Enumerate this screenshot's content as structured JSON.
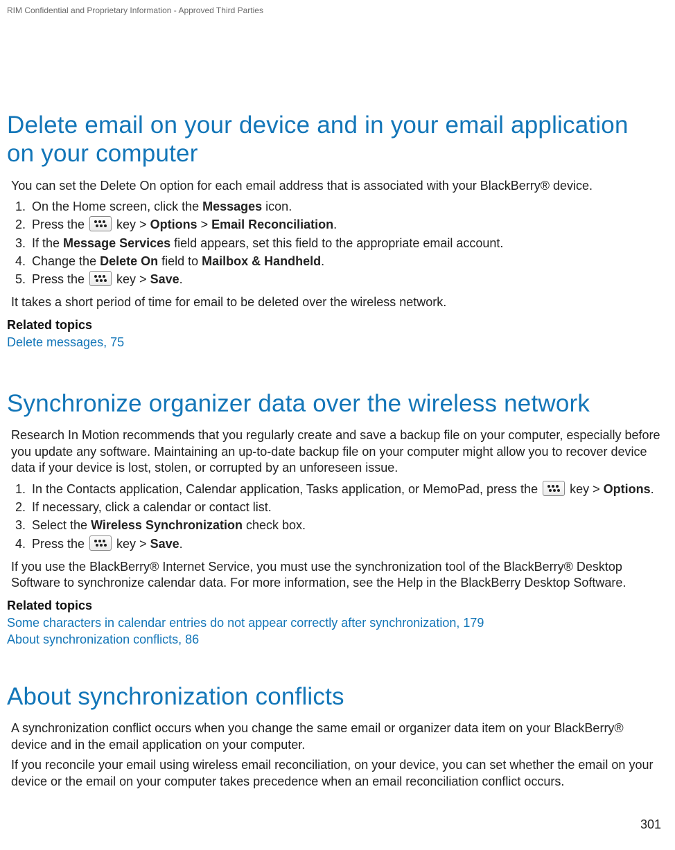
{
  "header": {
    "confidential": "RIM Confidential and Proprietary Information - Approved Third Parties"
  },
  "page_number": "301",
  "section1": {
    "title": "Delete email on your device and in your email application on your computer",
    "intro": "You can set the Delete On option for each email address that is associated with your BlackBerry® device.",
    "steps": {
      "s1_a": "On the Home screen, click the ",
      "s1_b": "Messages",
      "s1_c": " icon.",
      "s2_a": "Press the ",
      "s2_b": " key > ",
      "s2_c": "Options",
      "s2_d": " > ",
      "s2_e": "Email Reconciliation",
      "s2_f": ".",
      "s3_a": "If the ",
      "s3_b": "Message Services",
      "s3_c": " field appears, set this field to the appropriate email account.",
      "s4_a": "Change the ",
      "s4_b": "Delete On",
      "s4_c": " field to ",
      "s4_d": "Mailbox & Handheld",
      "s4_e": ".",
      "s5_a": "Press the ",
      "s5_b": " key > ",
      "s5_c": "Save",
      "s5_d": "."
    },
    "note": "It takes a short period of time for email to be deleted over the wireless network.",
    "related_label": "Related topics",
    "related_link": "Delete messages, 75"
  },
  "section2": {
    "title": "Synchronize organizer data over the wireless network",
    "intro": "Research In Motion recommends that you regularly create and save a backup file on your computer, especially before you update any software. Maintaining an up-to-date backup file on your computer might allow you to recover device data if your device is lost, stolen, or corrupted by an unforeseen issue.",
    "steps": {
      "s1_a": "In the Contacts application, Calendar application, Tasks application, or MemoPad, press the ",
      "s1_b": " key > ",
      "s1_c": "Options",
      "s1_d": ".",
      "s2": "If necessary, click a calendar or contact list.",
      "s3_a": "Select the ",
      "s3_b": "Wireless Synchronization",
      "s3_c": " check box.",
      "s4_a": "Press the ",
      "s4_b": " key > ",
      "s4_c": "Save",
      "s4_d": "."
    },
    "note": "If you use the BlackBerry® Internet Service, you must use the synchronization tool of the BlackBerry® Desktop Software to synchronize calendar data. For more information, see the Help in the BlackBerry Desktop Software.",
    "related_label": "Related topics",
    "related_link1": "Some characters in calendar entries do not appear correctly after synchronization, 179",
    "related_link2": "About synchronization conflicts, 86"
  },
  "section3": {
    "title": "About synchronization conflicts",
    "p1": "A synchronization conflict occurs when you change the same email or organizer data item on your BlackBerry® device and in the email application on your computer.",
    "p2": "If you reconcile your email using wireless email reconciliation, on your device, you can set whether the email on your device or the email on your computer takes precedence when an email reconciliation conflict occurs."
  }
}
